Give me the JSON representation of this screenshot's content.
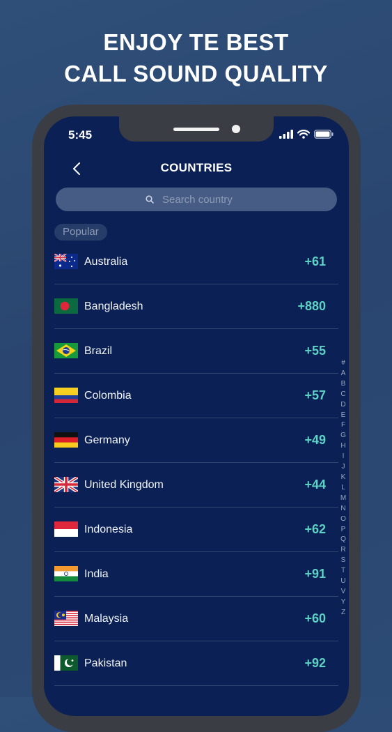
{
  "headline": {
    "line1": "ENJOY TE BEST",
    "line2": "CALL SOUND QUALITY"
  },
  "status_bar": {
    "time": "5:45"
  },
  "header": {
    "title": "COUNTRIES"
  },
  "search": {
    "placeholder": "Search country"
  },
  "section_label": "Popular",
  "countries": [
    {
      "name": "Australia",
      "code": "+61"
    },
    {
      "name": "Bangladesh",
      "code": "+880"
    },
    {
      "name": "Brazil",
      "code": "+55"
    },
    {
      "name": "Colombia",
      "code": "+57"
    },
    {
      "name": "Germany",
      "code": "+49"
    },
    {
      "name": "United Kingdom",
      "code": "+44"
    },
    {
      "name": "Indonesia",
      "code": "+62"
    },
    {
      "name": "India",
      "code": "+91"
    },
    {
      "name": "Malaysia",
      "code": "+60"
    },
    {
      "name": "Pakistan",
      "code": "+92"
    }
  ],
  "alpha_index": [
    "#",
    "A",
    "B",
    "C",
    "D",
    "E",
    "F",
    "G",
    "H",
    "I",
    "J",
    "K",
    "L",
    "M",
    "N",
    "O",
    "P",
    "Q",
    "R",
    "S",
    "T",
    "U",
    "V",
    "Y",
    "Z"
  ],
  "colors": {
    "background": "#2b4a74",
    "screen": "#0b2156",
    "accent_code": "#5fd0c4"
  }
}
